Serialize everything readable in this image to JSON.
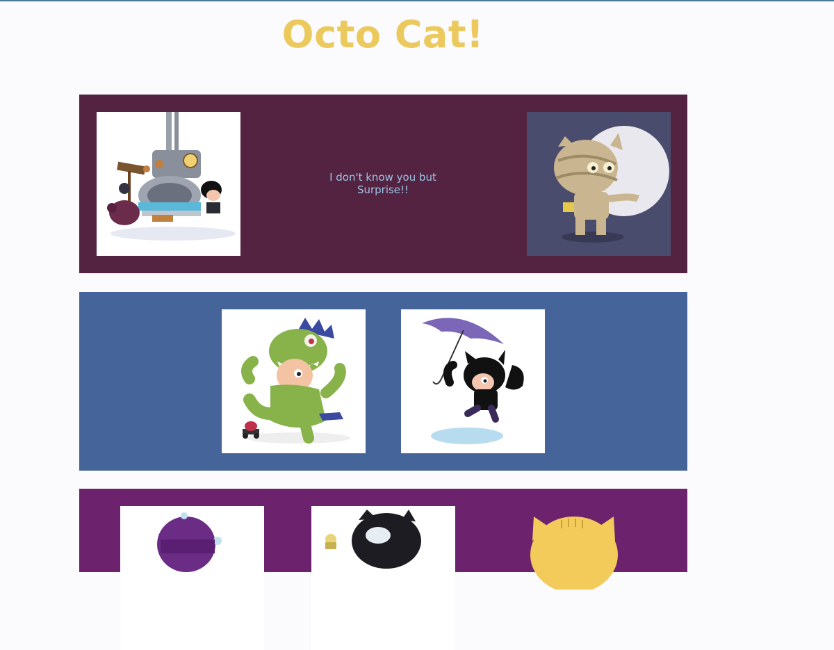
{
  "page": {
    "title": "Octo Cat!"
  },
  "section1": {
    "message_line1": "I don't know you but",
    "message_line2": "Surprise!!",
    "images": [
      "machine-octocat-icon",
      "mummy-octocat-icon"
    ]
  },
  "section2": {
    "images": [
      "dinosaur-octocat-icon",
      "umbrella-octocat-icon"
    ]
  },
  "section3": {
    "images": [
      "beanie-octocat-icon",
      "goggles-octocat-icon",
      "yellow-cat-icon"
    ]
  },
  "colors": {
    "title": "#ecc95c",
    "section1_bg": "#542342",
    "section2_bg": "#45649a",
    "section3_bg": "#6c226d",
    "message_text": "#9fc3e4"
  }
}
